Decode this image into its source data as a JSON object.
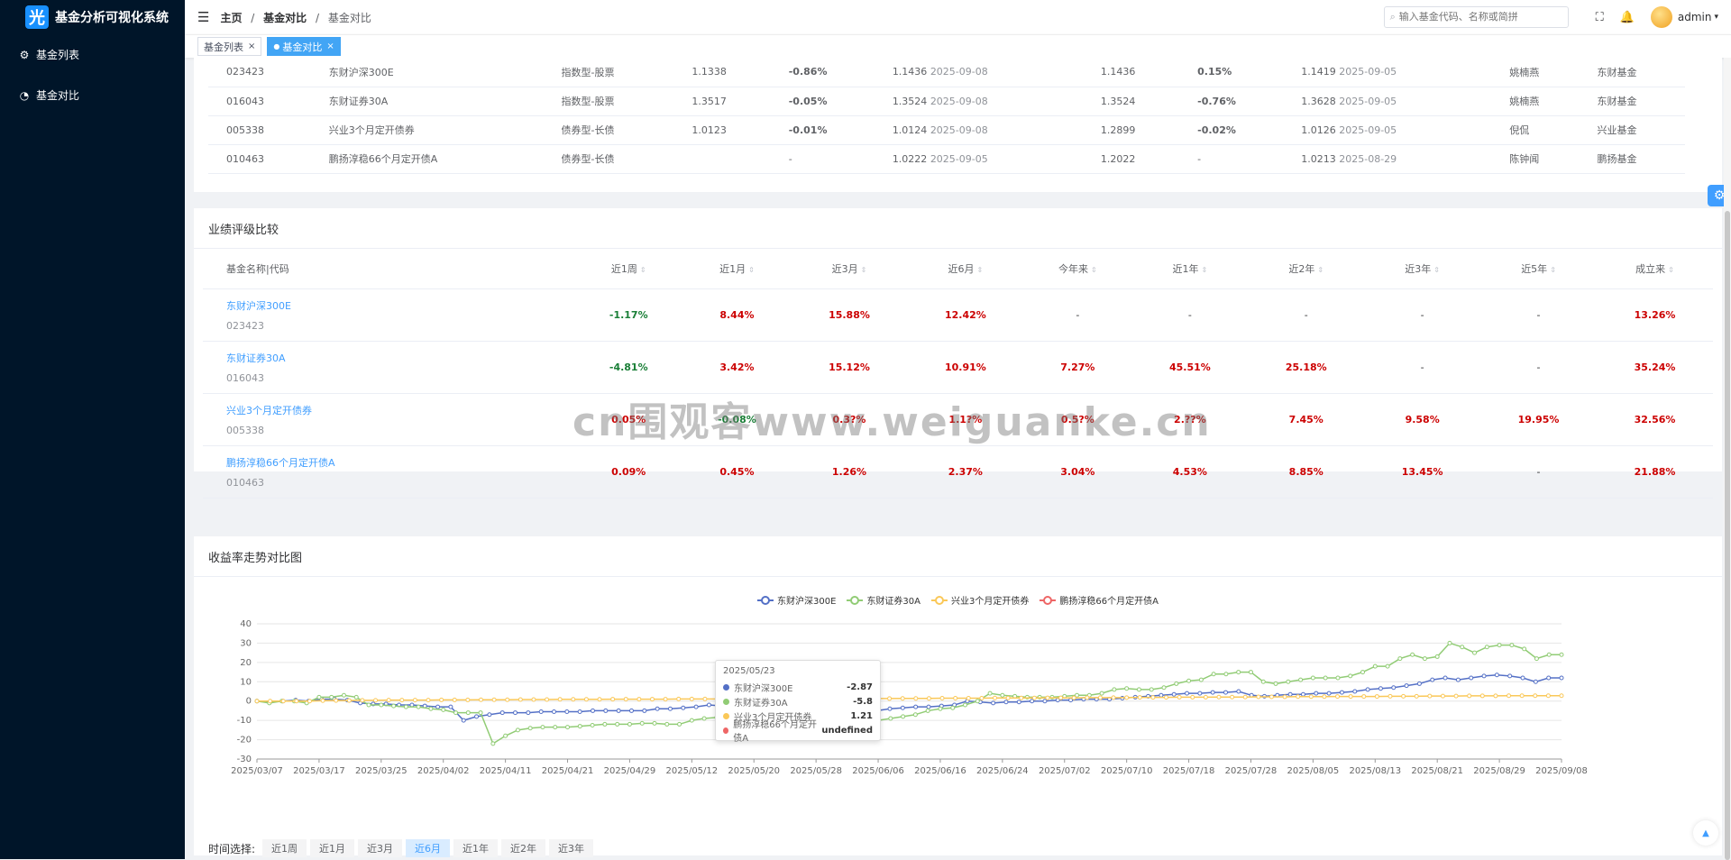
{
  "app": {
    "logo_char": "光",
    "title": "基金分析可视化系统"
  },
  "sidebar": {
    "items": [
      {
        "icon": "gear-icon",
        "label": "基金列表"
      },
      {
        "icon": "chart-icon",
        "label": "基金对比"
      }
    ]
  },
  "header": {
    "crumbs": [
      "主页",
      "基金对比",
      "基金对比"
    ],
    "sep": "/",
    "search_placeholder": "输入基金代码、名称或简拼",
    "user": "admin"
  },
  "tabs": [
    {
      "label": "基金列表",
      "active": false
    },
    {
      "label": "基金对比",
      "active": true
    }
  ],
  "top_table": {
    "rows": [
      [
        "023423",
        "东财沪深300E",
        "指数型-股票",
        "1.1338",
        "-0.86%",
        "1.1436",
        "2025-09-08",
        "1.1436",
        "0.15%",
        "1.1419",
        "2025-09-05",
        "姚楠燕",
        "东财基金"
      ],
      [
        "016043",
        "东财证券30A",
        "指数型-股票",
        "1.3517",
        "-0.05%",
        "1.3524",
        "2025-09-08",
        "1.3524",
        "-0.76%",
        "1.3628",
        "2025-09-05",
        "姚楠燕",
        "东财基金"
      ],
      [
        "005338",
        "兴业3个月定开债券",
        "债券型-长债",
        "1.0123",
        "-0.01%",
        "1.0124",
        "2025-09-08",
        "1.2899",
        "-0.02%",
        "1.0126",
        "2025-09-05",
        "倪侃",
        "兴业基金"
      ],
      [
        "010463",
        "鹏扬淳稳66个月定开债A",
        "债券型-长债",
        "",
        "-",
        "1.0222",
        "2025-09-05",
        "1.2022",
        "-",
        "1.0213",
        "2025-08-29",
        "陈钟闻",
        "鹏扬基金"
      ]
    ]
  },
  "perf": {
    "title": "业绩评级比较",
    "headers": [
      "基金名称|代码",
      "近1周",
      "近1月",
      "近3月",
      "近6月",
      "今年来",
      "近1年",
      "近2年",
      "近3年",
      "近5年",
      "成立来"
    ],
    "rows": [
      {
        "name": "东财沪深300E",
        "code": "023423",
        "vals": [
          "-1.17%",
          "8.44%",
          "15.88%",
          "12.42%",
          "-",
          "-",
          "-",
          "-",
          "-",
          "13.26%"
        ]
      },
      {
        "name": "东财证券30A",
        "code": "016043",
        "vals": [
          "-4.81%",
          "3.42%",
          "15.12%",
          "10.91%",
          "7.27%",
          "45.51%",
          "25.18%",
          "-",
          "-",
          "35.24%"
        ]
      },
      {
        "name": "兴业3个月定开债券",
        "code": "005338",
        "vals": [
          "0.05%",
          "-0.08%",
          "0.3?%",
          "1.1?%",
          "0.5?%",
          "2.??%",
          "7.45%",
          "9.58%",
          "19.95%",
          "32.56%"
        ]
      },
      {
        "name": "鹏扬淳稳66个月定开债A",
        "code": "010463",
        "vals": [
          "0.09%",
          "0.45%",
          "1.26%",
          "2.37%",
          "3.04%",
          "4.53%",
          "8.85%",
          "13.45%",
          "-",
          "21.88%"
        ]
      }
    ]
  },
  "chart_section": {
    "title": "收益率走势对比图"
  },
  "chart_data": {
    "type": "line",
    "x_ticks": [
      "2025/03/07",
      "2025/03/17",
      "2025/03/25",
      "2025/04/02",
      "2025/04/11",
      "2025/04/21",
      "2025/04/29",
      "2025/05/12",
      "2025/05/20",
      "2025/05/28",
      "2025/06/06",
      "2025/06/16",
      "2025/06/24",
      "2025/07/02",
      "2025/07/10",
      "2025/07/18",
      "2025/07/28",
      "2025/08/05",
      "2025/08/13",
      "2025/08/21",
      "2025/08/29",
      "2025/09/08"
    ],
    "ylim": [
      -30,
      40
    ],
    "y_ticks": [
      -30,
      -20,
      -10,
      0,
      10,
      20,
      30,
      40
    ],
    "series": [
      {
        "name": "东财沪深300E",
        "color": "#5470c6",
        "values": [
          0,
          -0.5,
          0,
          0.5,
          0,
          1,
          1,
          0.5,
          -1,
          -1.5,
          -1.5,
          -2,
          -2,
          -2.5,
          -3,
          -3,
          -10,
          -8,
          -7,
          -6,
          -6,
          -6,
          -5.5,
          -5.5,
          -5.5,
          -5.5,
          -5,
          -5,
          -5,
          -5,
          -5,
          -4,
          -4,
          -3.5,
          -3,
          -2,
          -2.5,
          -3,
          -3,
          -3,
          -2.5,
          -2.5,
          -2.87,
          -3,
          -4,
          -4.5,
          -5,
          -5,
          -5,
          -4,
          -3.5,
          -3,
          -3,
          -2.5,
          -2,
          0,
          -0.5,
          -1,
          -0.5,
          -0.5,
          0,
          0,
          0.5,
          0.5,
          1,
          1,
          1,
          1.5,
          2,
          2.5,
          3,
          3.5,
          4,
          4,
          4.5,
          4.5,
          5,
          3,
          2.5,
          3,
          3.5,
          3.5,
          4,
          4,
          4.5,
          5,
          6,
          6.5,
          7,
          8,
          9,
          11,
          12,
          11,
          12,
          13,
          13.5,
          13,
          12,
          10,
          12,
          12
        ]
      },
      {
        "name": "东财证券30A",
        "color": "#91cc75",
        "values": [
          0,
          -1,
          0,
          0,
          -1,
          2,
          2,
          3,
          2,
          -2,
          -2,
          -2.5,
          -3,
          -3,
          -4,
          -4.5,
          -6,
          -6,
          -6,
          -22,
          -18,
          -15,
          -14,
          -13.5,
          -13.5,
          -13.5,
          -13,
          -12.5,
          -12,
          -12,
          -12,
          -11.5,
          -11.5,
          -12,
          -12,
          -10,
          -9,
          -8.5,
          -9.5,
          -7,
          -5,
          -5,
          -6.5,
          -7,
          -6.5,
          -6,
          -7,
          -5.8,
          -10,
          -11,
          -10,
          -9,
          -8,
          -7,
          -5,
          -4,
          -3.5,
          -2,
          0,
          4,
          3,
          2.5,
          2,
          2,
          2,
          2.5,
          3,
          3,
          4,
          6,
          6.5,
          6,
          6,
          7,
          9,
          10.5,
          11,
          14,
          14,
          15,
          15,
          10,
          9,
          10,
          11,
          12,
          12,
          12,
          13,
          15,
          18,
          18,
          22,
          24,
          22,
          23,
          30,
          28,
          25,
          28,
          29,
          29,
          27,
          22,
          24,
          24
        ]
      },
      {
        "name": "兴业3个月定开债券",
        "color": "#fac858",
        "values": [
          0,
          0,
          0,
          0,
          0,
          0.2,
          0.3,
          0.3,
          0.4,
          0.4,
          0.5,
          0.5,
          0.5,
          0.5,
          0.6,
          0.6,
          0.6,
          0.7,
          0.7,
          0.7,
          0.8,
          0.8,
          0.8,
          0.9,
          0.9,
          0.9,
          0.9,
          1,
          1,
          1,
          1,
          1,
          1.1,
          1.1,
          1.1,
          1.1,
          1.1,
          1.2,
          1.2,
          1.21,
          1.2,
          1.2,
          1.21,
          1.2,
          1.3,
          1.3,
          1.3,
          1.3,
          1.3,
          1.4,
          1.4,
          1.4,
          1.5,
          1.5,
          1.5,
          1.5,
          1.6,
          1.6,
          1.6,
          1.6,
          1.7,
          1.7,
          1.7,
          1.8,
          1.8,
          1.8,
          1.8,
          1.9,
          1.9,
          1.9,
          2,
          2,
          2,
          2.1,
          2.1,
          2.1,
          2.2,
          2.2,
          2.2,
          2.3,
          2.3,
          2.3,
          2.4,
          2.4,
          2.4,
          2.4,
          2.5,
          2.5,
          2.5,
          2.6,
          2.6,
          2.6,
          2.7,
          2.7,
          2.7,
          2.8,
          2.8,
          2.8,
          2.8,
          2.8
        ]
      },
      {
        "name": "鹏扬淳稳66个月定开债A",
        "color": "#ee6666",
        "values": []
      }
    ],
    "legend_position": "top"
  },
  "tooltip": {
    "date": "2025/05/23",
    "rows": [
      [
        "东财沪深300E",
        "-2.87"
      ],
      [
        "东财证券30A",
        "-5.8"
      ],
      [
        "兴业3个月定开债券",
        "1.21"
      ],
      [
        "鹏扬淳稳66个月定开债A",
        "undefined"
      ]
    ]
  },
  "time_select": {
    "label": "时间选择:",
    "options": [
      "近1周",
      "近1月",
      "近3月",
      "近6月",
      "近1年",
      "近2年",
      "近3年"
    ],
    "selected": "近6月"
  },
  "watermark": "cn围观客www.weiguanke.cn"
}
